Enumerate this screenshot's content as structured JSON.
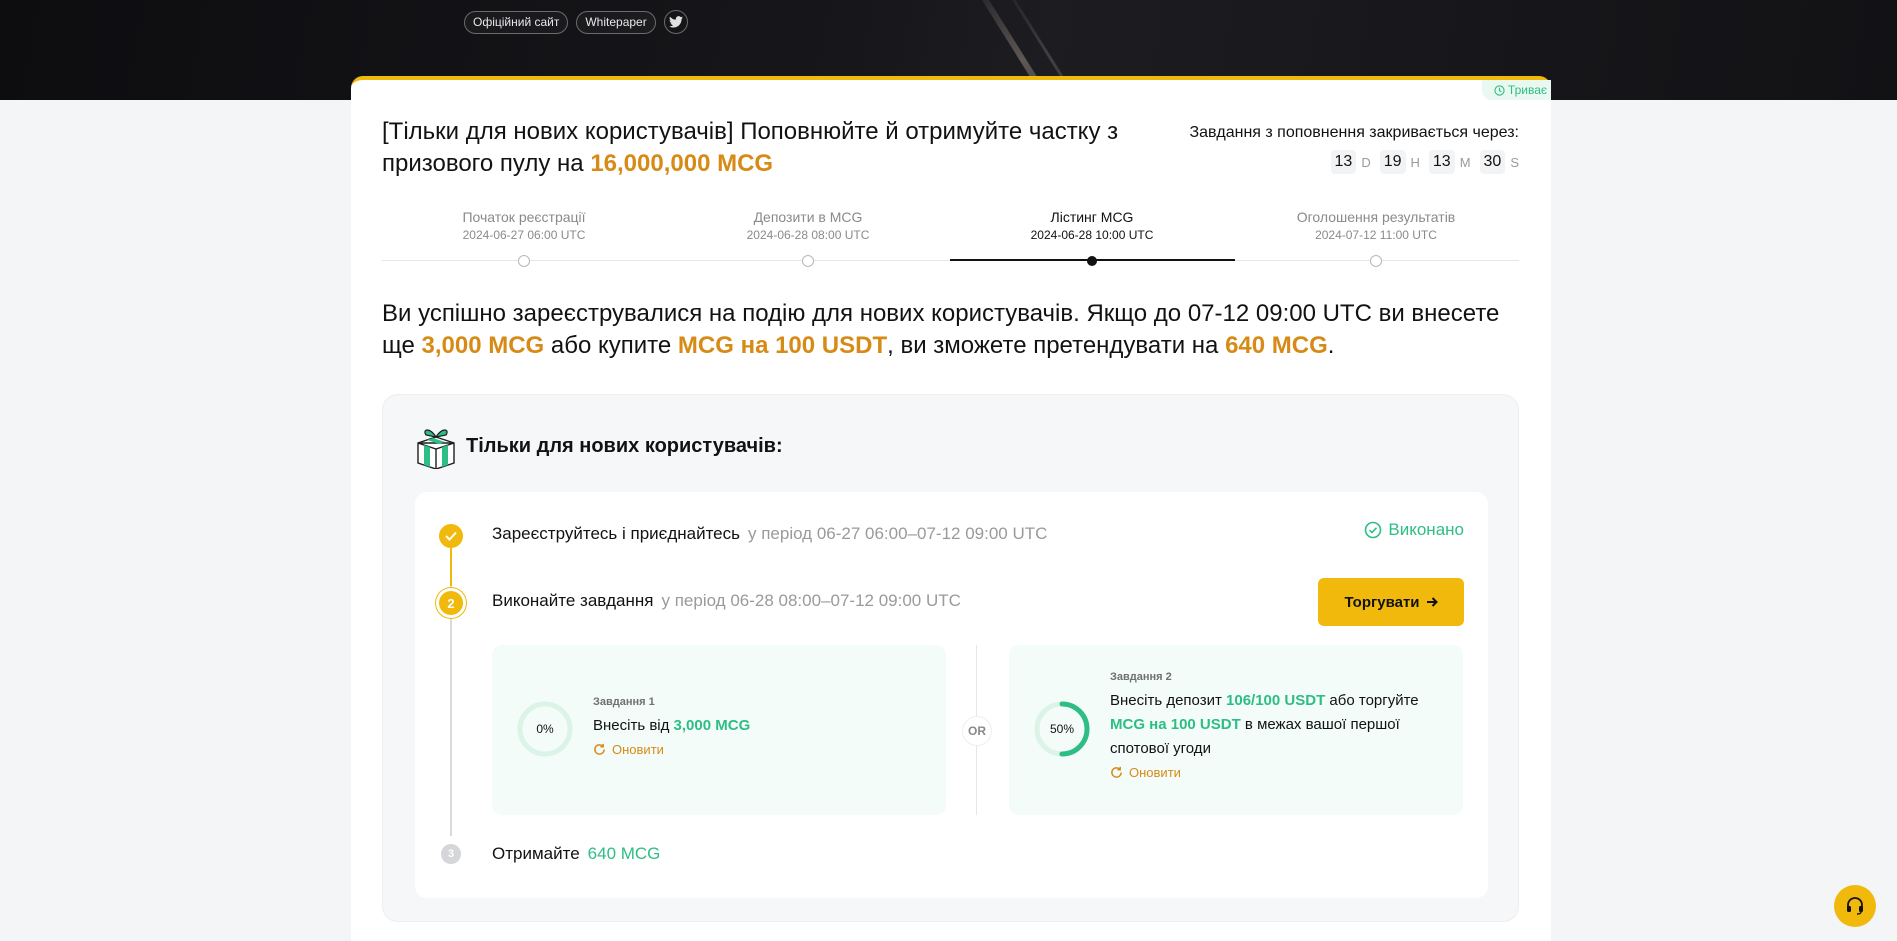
{
  "hero": {
    "official_site": "Офіційний сайт",
    "whitepaper": "Whitepaper",
    "social_icon": "twitter-icon"
  },
  "status_tag": "Триває",
  "title": {
    "prefix": "[Тільки для нових користувачів] Поповнюйте й отримуйте частку з призового пулу на ",
    "amount": "16,000,000 MCG"
  },
  "countdown": {
    "label": "Завдання з поповнення закривається через:",
    "days": "13",
    "days_unit": "D",
    "hours": "19",
    "hours_unit": "H",
    "minutes": "13",
    "minutes_unit": "M",
    "seconds": "30",
    "seconds_unit": "S"
  },
  "timeline": [
    {
      "name": "Початок реєстрації",
      "date": "2024-06-27 06:00 UTC"
    },
    {
      "name": "Депозити в MCG",
      "date": "2024-06-28 08:00 UTC"
    },
    {
      "name": "Лістинг MCG",
      "date": "2024-06-28 10:00 UTC"
    },
    {
      "name": "Оголошення результатів",
      "date": "2024-07-12 11:00 UTC"
    }
  ],
  "headline": {
    "part1": "Ви успішно зареєструвалися на подію для нових користувачів. Якщо до 07-12 09:00 UTC ви внесете ще ",
    "amount1": "3,000 MCG",
    "part2": " або купите ",
    "amount2": "MCG на 100 USDT",
    "part3": ", ви зможете претендувати на ",
    "amount3": "640 MCG",
    "part4": "."
  },
  "panel": {
    "title": "Тільки для нових користувачів:",
    "step1": {
      "label": "Зареєструйтесь і приєднайтесь",
      "period": "у період 06-27 06:00–07-12 09:00 UTC",
      "status": "Виконано"
    },
    "step2": {
      "number": "2",
      "label": "Виконайте завдання",
      "period": "у період 06-28 08:00–07-12 09:00 UTC",
      "button": "Торгувати"
    },
    "task1": {
      "name": "Завдання 1",
      "progress_label": "0%",
      "progress": 0,
      "desc_prefix": "Внесіть від ",
      "desc_amount": "3,000 MCG",
      "refresh": "Оновити"
    },
    "or_label": "OR",
    "task2": {
      "name": "Завдання 2",
      "progress_label": "50%",
      "progress": 0.5,
      "desc1": "Внесіть депозит ",
      "amount1": "106/100 USDT",
      "desc2": " або торгуйте ",
      "amount2": "MCG на 100 USDT",
      "desc3": " в межах вашої першої спотової угоди",
      "refresh": "Оновити"
    },
    "step3": {
      "number": "3",
      "label": "Отримайте",
      "reward": "640 MCG"
    }
  },
  "colors": {
    "accent": "#f0b90b",
    "gold_text": "#d78b16",
    "success": "#2ebd85"
  }
}
